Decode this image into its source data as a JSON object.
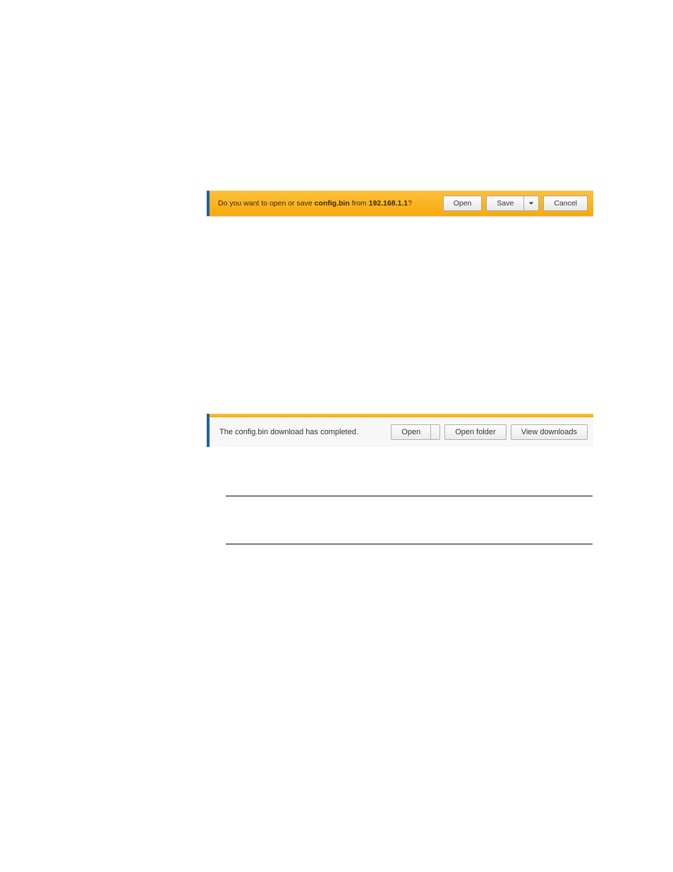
{
  "bar1": {
    "msg_prefix": "Do you want to open or save ",
    "filename": "config.bin",
    "msg_mid": " from ",
    "host": "192.168.1.1",
    "msg_suffix": "?",
    "open": "Open",
    "save": "Save",
    "cancel": "Cancel"
  },
  "bar2": {
    "msg": "The config.bin download has completed.",
    "open": "Open",
    "open_folder": "Open folder",
    "view_downloads": "View downloads"
  }
}
